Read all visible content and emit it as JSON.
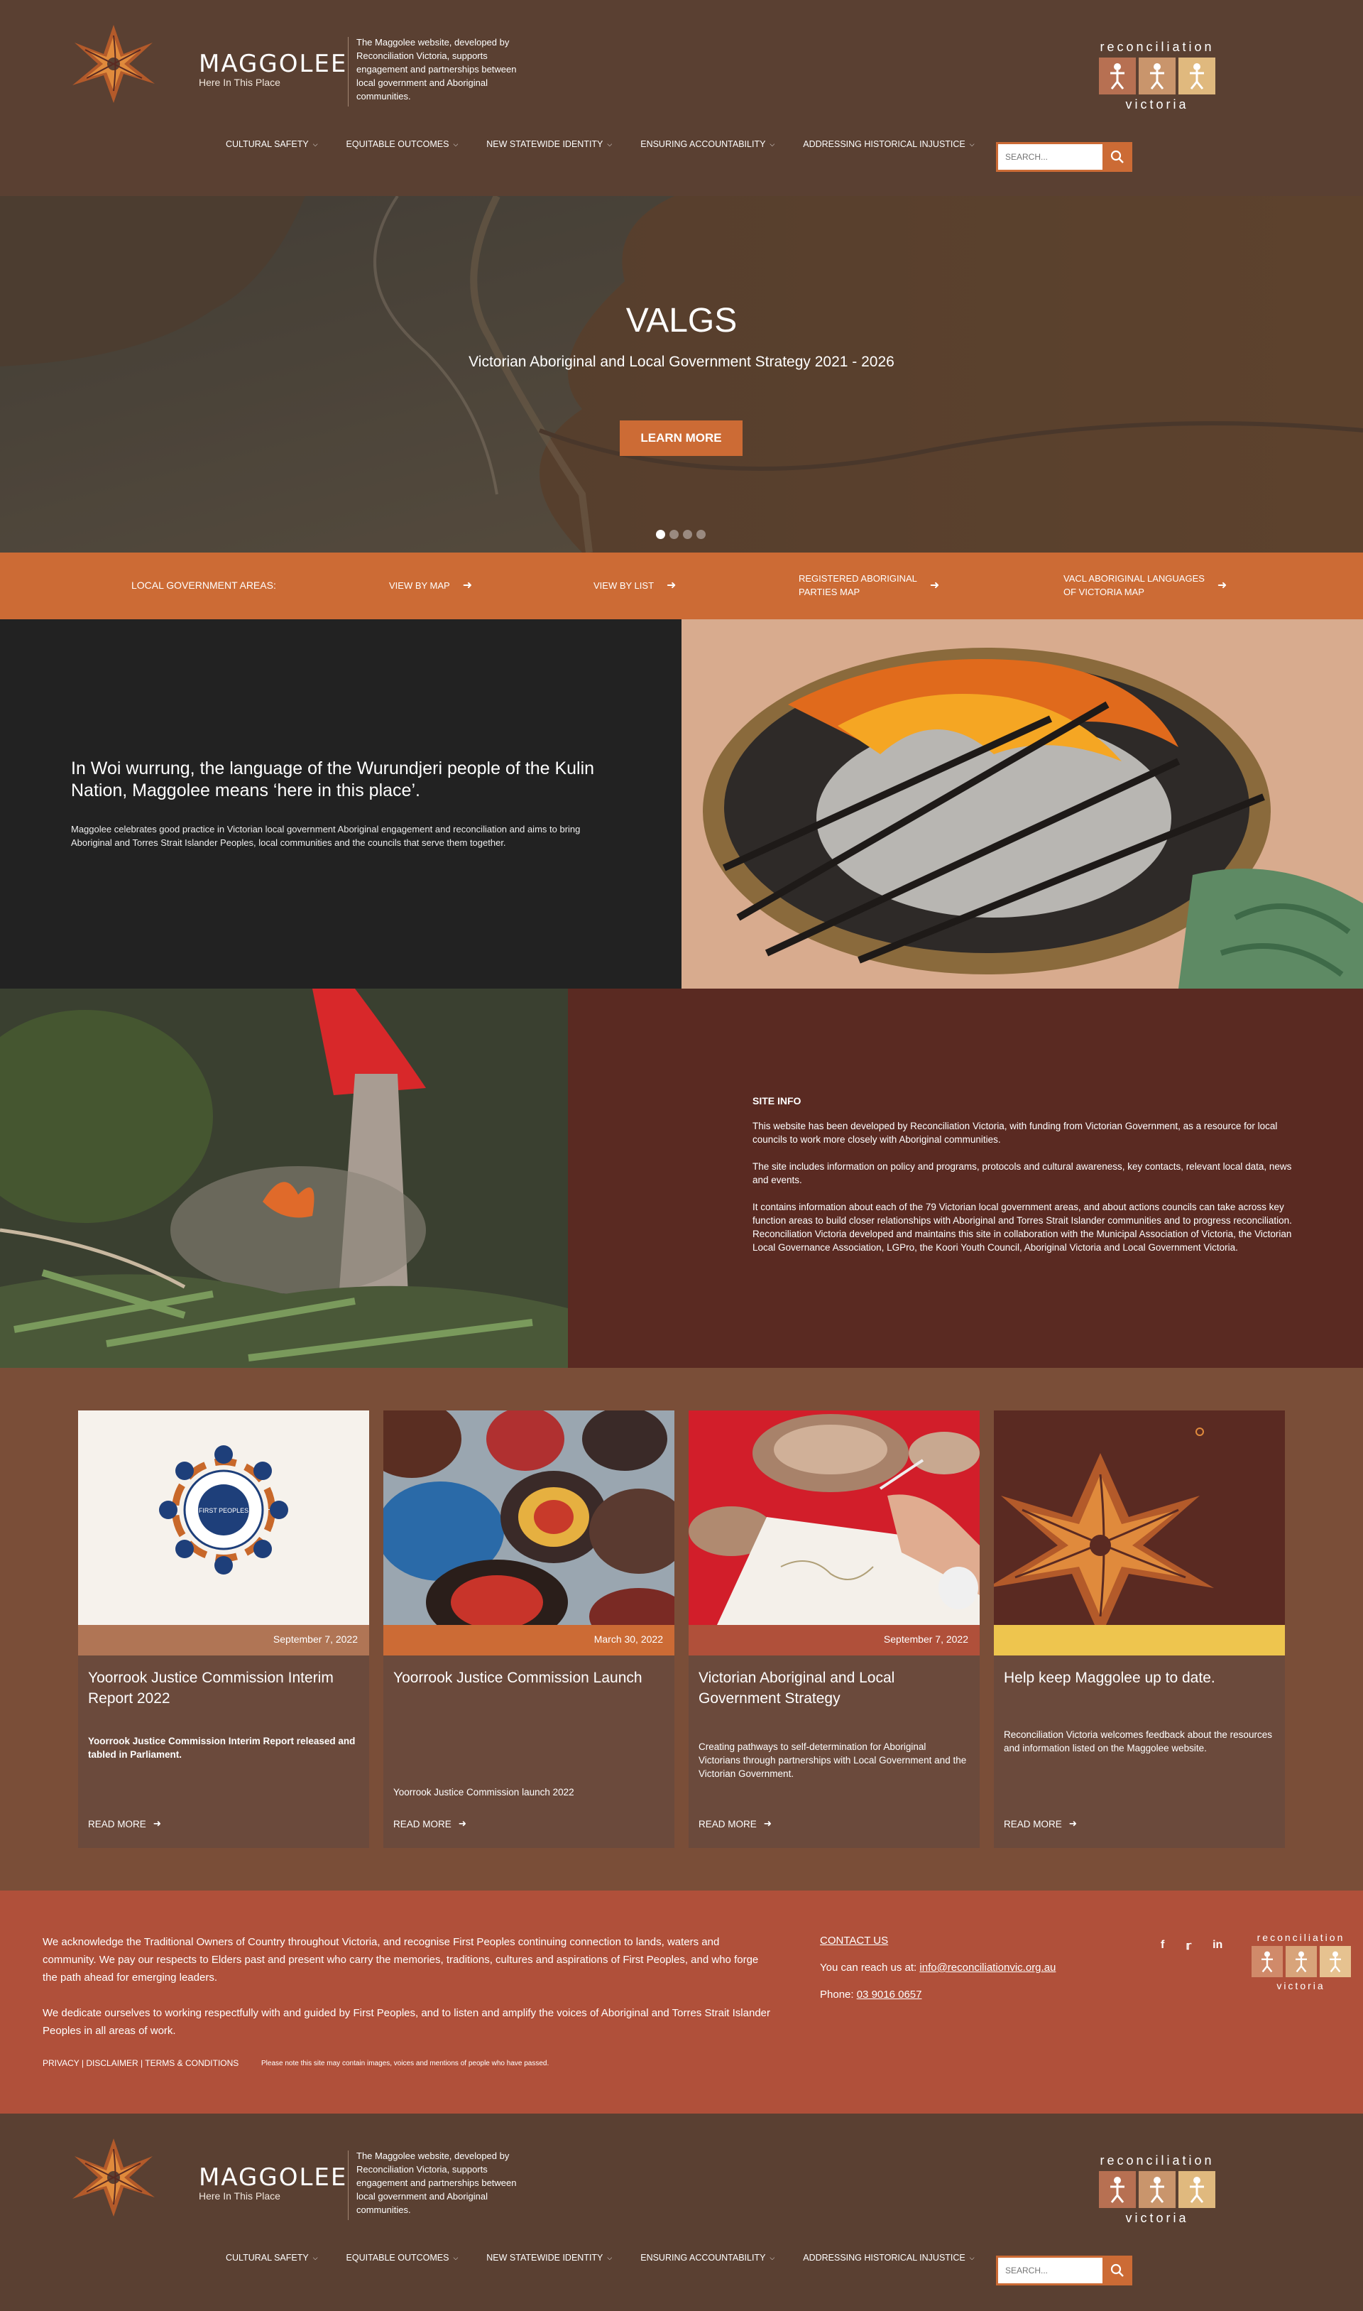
{
  "brand": {
    "name": "MAGGOLEE",
    "tagline": "Here In This Place",
    "description": "The Maggolee website, developed by Reconciliation Victoria, supports engagement and partnerships between local government and Aboriginal communities."
  },
  "partner_logo": {
    "top": "reconciliation",
    "bottom": "victoria"
  },
  "nav": {
    "items": [
      {
        "label": "CULTURAL SAFETY"
      },
      {
        "label": "EQUITABLE OUTCOMES"
      },
      {
        "label": "NEW STATEWIDE IDENTITY"
      },
      {
        "label": "ENSURING ACCOUNTABILITY"
      },
      {
        "label": "ADDRESSING HISTORICAL INJUSTICE"
      }
    ],
    "search_placeholder": "SEARCH..."
  },
  "hero": {
    "title": "VALGS",
    "subtitle": "Victorian Aboriginal and Local Government Strategy 2021 - 2026",
    "button": "LEARN MORE",
    "slide_count": 4,
    "active_slide": 1
  },
  "lga_bar": {
    "label": "LOCAL GOVERNMENT AREAS:",
    "links": [
      {
        "line1": "VIEW BY MAP",
        "line2": ""
      },
      {
        "line1": "VIEW BY LIST",
        "line2": ""
      },
      {
        "line1": "REGISTERED ABORIGINAL",
        "line2": "PARTIES MAP"
      },
      {
        "line1": "VACL ABORIGINAL LANGUAGES",
        "line2": "OF VICTORIA MAP"
      }
    ]
  },
  "intro": {
    "heading": "In Woi wurrung, the language of the Wurundjeri people of the Kulin Nation, Maggolee means ‘here in this place’.",
    "text": "Maggolee celebrates good practice in Victorian local government Aboriginal engagement and reconciliation and aims to bring Aboriginal and Torres Strait Islander Peoples, local communities and the councils that serve them together."
  },
  "site_info": {
    "title": "SITE INFO",
    "paragraphs": [
      "This website has been developed by Reconciliation Victoria, with funding from Victorian Government, as a resource for local councils to work more closely with Aboriginal communities.",
      "The site includes information on policy and programs, protocols and cultural awareness, key contacts, relevant local data, news and events.",
      "It contains information about each of the 79 Victorian local government areas, and about actions councils can take across key function areas to build closer relationships with Aboriginal and Torres Strait Islander communities and to progress reconciliation. Reconciliation Victoria developed and maintains this site in collaboration with the Municipal Association of Victoria, the Victorian Local Governance Association, LGPro, the Koori Youth Council, Aboriginal Victoria and Local Government Victoria."
    ]
  },
  "cards": [
    {
      "date": "September 7, 2022",
      "title": "Yoorrook Justice Commission Interim Report 2022",
      "excerpt": "Yoorrook Justice Commission Interim Report released and tabled in Parliament.",
      "read_more": "READ MORE",
      "badge": "FIRST PEOPLES",
      "date_color": "#b07555"
    },
    {
      "date": "March 30, 2022",
      "title": "Yoorrook Justice Commission Launch",
      "excerpt": "Yoorrook Justice Commission launch 2022",
      "read_more": "READ MORE",
      "date_color": "#cc6b35"
    },
    {
      "date": "September 7, 2022",
      "title": "Victorian Aboriginal and Local Government Strategy",
      "excerpt": "Creating pathways to self-determination for Aboriginal Victorians through partnerships with Local Government and the Victorian Government.",
      "read_more": "READ MORE",
      "date_color": "#b0503a"
    },
    {
      "date": "",
      "title": "Help keep Maggolee up to date.",
      "excerpt": "Reconciliation Victoria welcomes feedback about the resources and information listed on the Maggolee website.",
      "read_more": "READ MORE",
      "date_color": "#eec54e"
    }
  ],
  "acknowledgement": {
    "p1": "We acknowledge the Traditional Owners of Country throughout Victoria, and recognise First Peoples continuing connection to lands, waters and community. We pay our respects to Elders past and present who carry the memories, traditions, cultures and aspirations of First Peoples, and who forge the path ahead for emerging leaders.",
    "p2": "We dedicate ourselves to working respectfully with and guided by First Peoples, and to listen and amplify the voices of Aboriginal and Torres Strait Islander Peoples in all areas of work.",
    "links": "PRIVACY | DISCLAIMER | TERMS & CONDITIONS",
    "note": "Please note this site may contain images, voices and mentions of people who have passed."
  },
  "contact": {
    "heading": "CONTACT US",
    "email_prefix": "You can reach us at: ",
    "email": "info@reconciliationvic.org.au",
    "phone_prefix": "Phone: ",
    "phone": "03 9016 0657",
    "social": [
      "f",
      "t",
      "in"
    ]
  },
  "colors": {
    "brown": "#5a4032",
    "orange": "#cc6b35",
    "dark": "#222222",
    "maroon": "#5a2a22",
    "terracotta": "#b0503a"
  }
}
